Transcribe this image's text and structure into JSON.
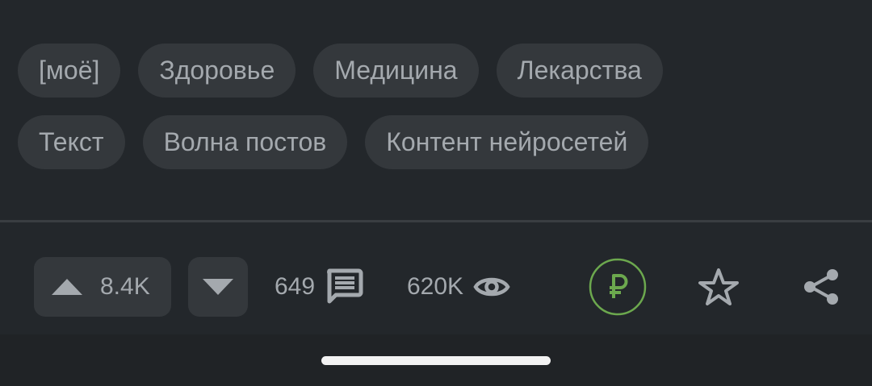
{
  "tags": {
    "row1": [
      "[моё]",
      "Здоровье",
      "Медицина",
      "Лекарства"
    ],
    "row2": [
      "Текст",
      "Волна постов",
      "Контент нейросетей"
    ]
  },
  "actions": {
    "rating": "8.4K",
    "comments_count": "649",
    "views_count": "620K"
  },
  "icons": {
    "vote_up": "triangle-up-icon",
    "vote_down": "triangle-down-icon",
    "comments": "comment-icon",
    "views": "eye-icon",
    "donate": "ruble-icon",
    "save": "star-icon",
    "share": "share-icon"
  },
  "colors": {
    "background": "#23272b",
    "tag_bg": "#34383c",
    "text": "#a4a9ae",
    "donate_accent": "#6ca84e"
  }
}
